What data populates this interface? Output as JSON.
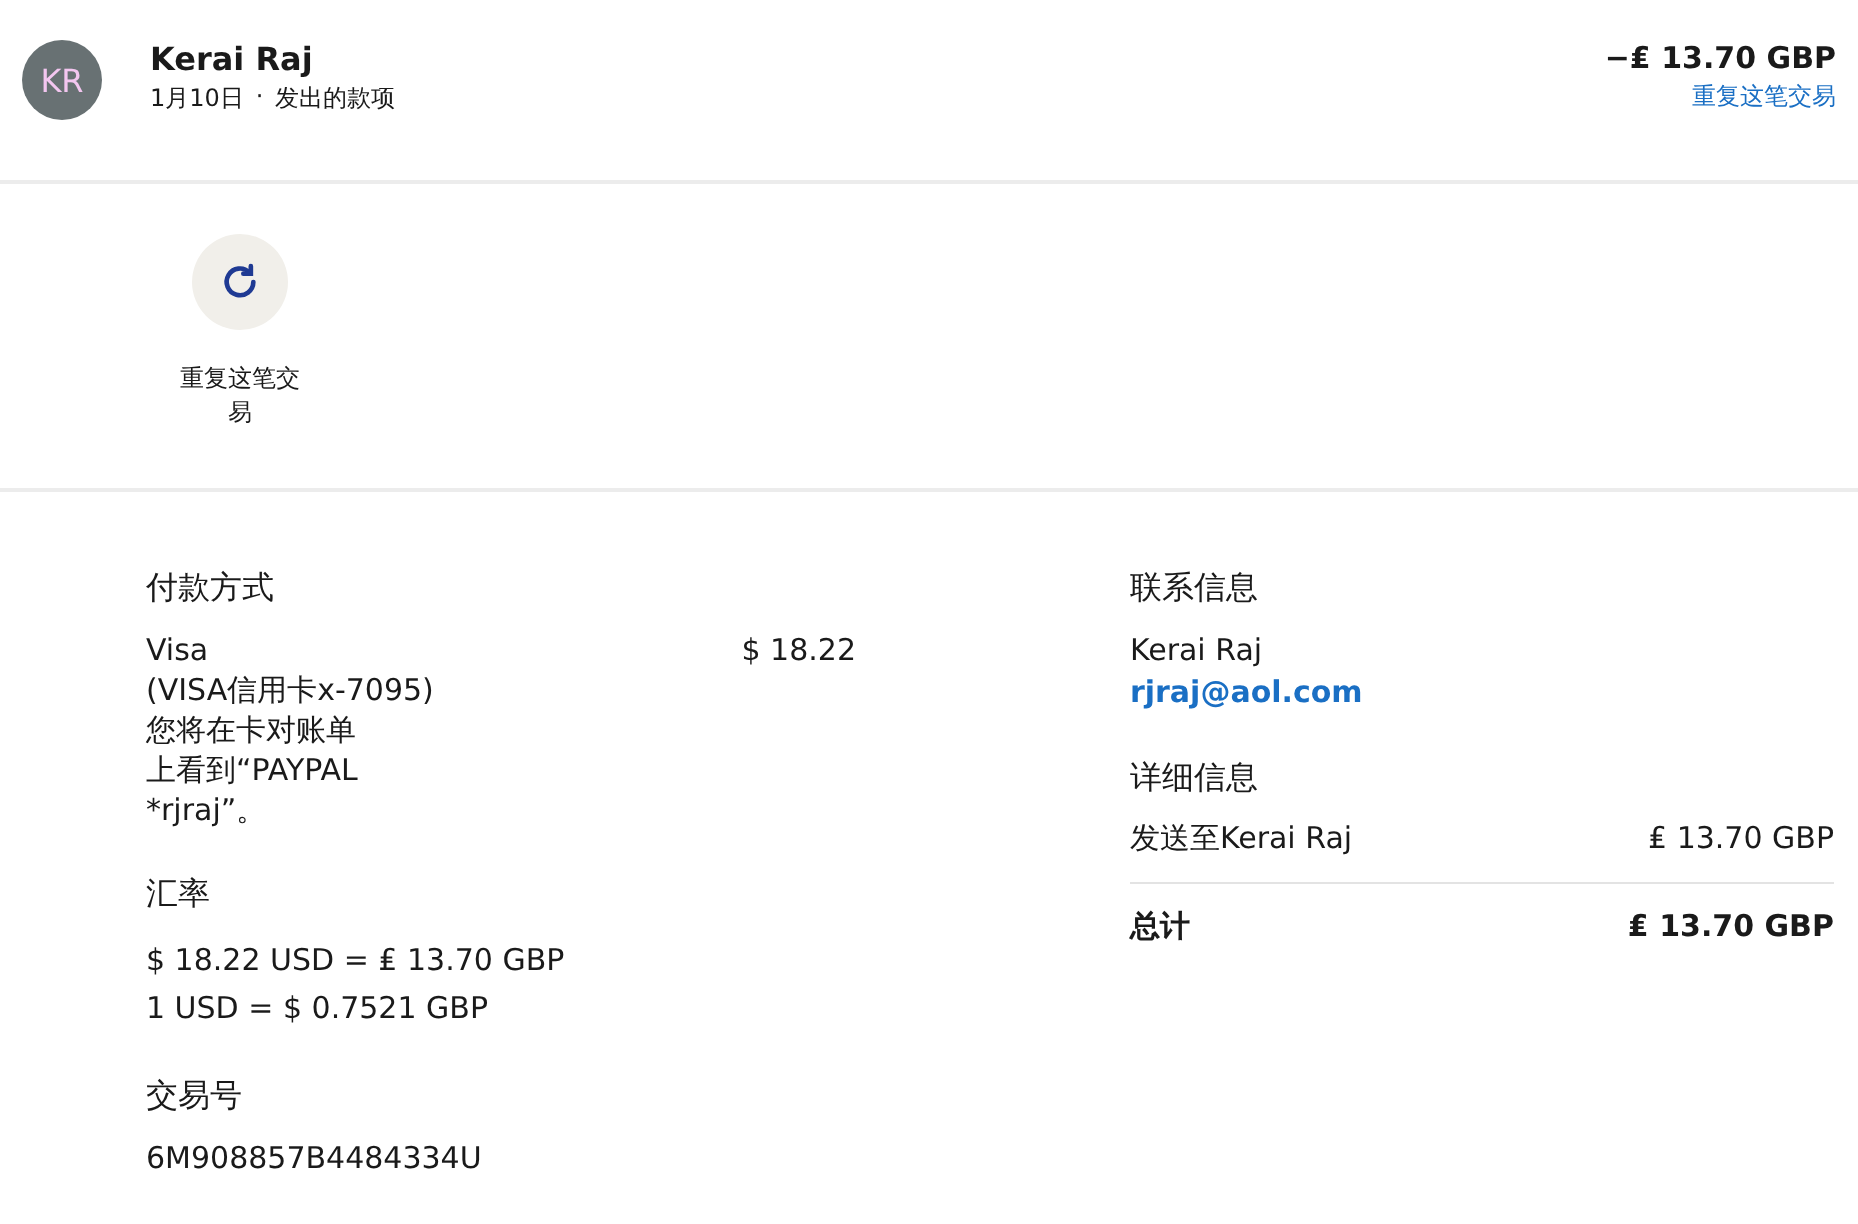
{
  "header": {
    "avatar": "KR",
    "name": "Kerai Raj",
    "date": "1月10日",
    "separator": "·",
    "type": "发出的款项",
    "amount": "−₤ 13.70 GBP",
    "repeat_link": "重复这笔交易"
  },
  "actions": [
    {
      "label": "重复这笔交易"
    }
  ],
  "payment": {
    "title": "付款方式",
    "lines": [
      "Visa",
      "(VISA信用卡x-7095)",
      "您将在卡对账单",
      "上看到“PAYPAL",
      "*rjraj”。"
    ],
    "amount": "$ 18.22"
  },
  "exchange": {
    "title": "汇率",
    "lines": [
      "$ 18.22 USD = ₤ 13.70 GBP",
      "1 USD = $ 0.7521 GBP"
    ]
  },
  "transaction": {
    "title": "交易号",
    "id": "6M908857B4484334U"
  },
  "contact": {
    "title": "联系信息",
    "name": "Kerai Raj",
    "email": "rjraj@aol.com"
  },
  "details": {
    "title": "详细信息",
    "rows": [
      {
        "label": "发送至Kerai Raj",
        "amount": "₤ 13.70 GBP",
        "kind": "item"
      },
      {
        "label": "总计",
        "amount": "₤ 13.70 GBP",
        "kind": "total"
      }
    ]
  }
}
